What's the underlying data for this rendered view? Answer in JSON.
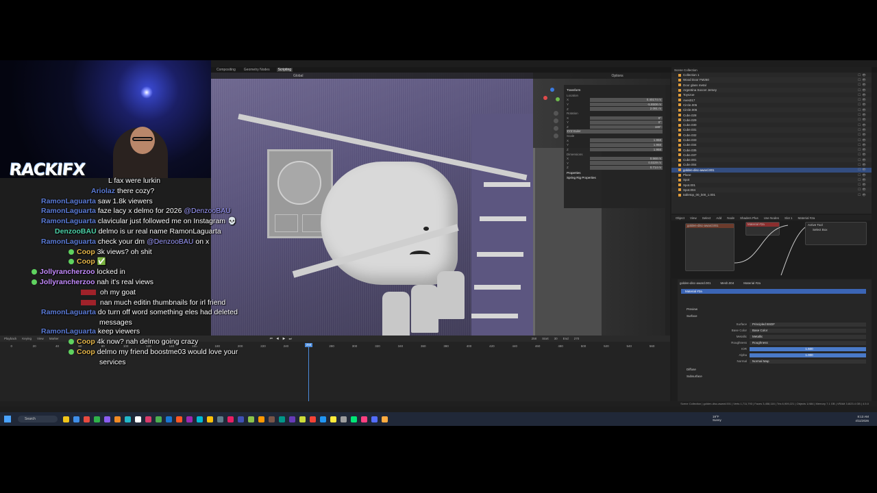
{
  "blender": {
    "workspaces": [
      "Compositing",
      "Geometry Nodes",
      "Scripting"
    ],
    "viewport_header": [
      "Global",
      "Options"
    ],
    "npanel": {
      "transform_title": "Transform",
      "location_label": "Location",
      "location": [
        "0.40174 m",
        "-5.8508 m",
        "2.091 m"
      ],
      "rotation_label": "Rotation",
      "rotation": [
        "0°",
        "0°",
        "180°"
      ],
      "rotation_mode": "XYZ Euler",
      "scale_label": "Scale",
      "scale": [
        "1.958",
        "1.958",
        "1.958"
      ],
      "dimensions_label": "Dimensions",
      "dimensions": [
        "0.568 m",
        "0.0229 m",
        "0.714 m"
      ],
      "properties_label": "Properties",
      "spring_label": "Spring Rig Properties"
    },
    "outliner": {
      "title": "Scene Collection",
      "items": [
        "Collection 1",
        "Wood Door FM260",
        "Door glass metal",
        "Argentina Soccer Jersey",
        "Toyszoe",
        "Aves017",
        "Circle.005",
        "Circle.006",
        "Cube.028",
        "Cube.029",
        "Cube.030",
        "Cube.031",
        "Cube.032",
        "Cube.033",
        "Cube.034",
        "Cube.035",
        "Cube.037",
        "Cube.001",
        "Cube.004",
        "golden-disc-award.001",
        "Plane",
        "Spot",
        "Spot.001",
        "Spot.004",
        "tabletop_00_k00_1.001"
      ],
      "selected_index": 19
    },
    "node_editor": {
      "header": [
        "Object",
        "View",
        "Select",
        "Add",
        "Node",
        "Shaders Plus",
        "Use Nodes",
        "Slot 1",
        "Material #2a"
      ],
      "nodes": [
        "golden-disc-award.001",
        "Material #2a",
        "Active Tool",
        "Select Box"
      ]
    },
    "properties": {
      "breadcrumb": [
        "golden-disc-award.001",
        "Mesh.004",
        "Material #2a"
      ],
      "slot": "Material #2a",
      "preview": "Preview",
      "surface_section": "Surface",
      "rows": [
        {
          "label": "Surface",
          "value": "Principled BSDF"
        },
        {
          "label": "Base Color",
          "value": "Base Color"
        },
        {
          "label": "Metallic",
          "value": "Metallic"
        },
        {
          "label": "Roughness",
          "value": "Roughness"
        },
        {
          "label": "IOR",
          "value": "1.500"
        },
        {
          "label": "Alpha",
          "value": "1.000"
        },
        {
          "label": "Normal",
          "value": "Normal Map"
        }
      ],
      "diffuse": "Diffuse",
      "subsurface": "Subsurface"
    },
    "timeline": {
      "header": [
        "Playback",
        "Keying",
        "View",
        "Marker"
      ],
      "ruler": [
        "0",
        "20",
        "40",
        "60",
        "80",
        "100",
        "120",
        "140",
        "160",
        "180",
        "200",
        "220",
        "240",
        "260",
        "280",
        "300",
        "320",
        "340",
        "360",
        "380",
        "400",
        "420",
        "440",
        "460",
        "480",
        "500",
        "520",
        "540",
        "560"
      ],
      "current_frame": "258",
      "start_label": "Start",
      "start": "30",
      "end_label": "End",
      "end": "270"
    },
    "status": "Scene Collection | golden-disc-award.001 | Verts 1,711,793 | Faces 3,458,116 | Tris 6,909,221 | Objects 1/484 | Memory 7.1 GB | VRAM 3.8/23.4 GB | 4.5.0"
  },
  "taskbar": {
    "search": "Search",
    "weather_temp": "19°F",
    "weather_desc": "Sunny",
    "time": "8:13 AM",
    "date": "4/11/2026"
  },
  "stream": {
    "logo": "RACKIFX",
    "chat": [
      {
        "user": "",
        "text": "L fax were lurkin",
        "user_color": "#ffffff"
      },
      {
        "user": "Ariolaz",
        "text": "there cozy?",
        "user_color": "#5b7bd6"
      },
      {
        "user": "RamonLaguarta",
        "text": "saw 1.8k viewers",
        "user_color": "#5b7bd6"
      },
      {
        "user": "RamonLaguarta",
        "text": "faze lacy x delmo for 2026",
        "mention": "@DenzooBAU",
        "user_color": "#5b7bd6"
      },
      {
        "user": "RamonLaguarta",
        "text": "clavicular just followed me on Instagram 💀",
        "user_color": "#5b7bd6"
      },
      {
        "user": "DenzooBAU",
        "text": "delmo is ur real name RamonLaguarta",
        "user_color": "#4cd2a8"
      },
      {
        "user": "RamonLaguarta",
        "text": "check your dm",
        "mention": "@DenzooBAU",
        "suffix": "on x",
        "user_color": "#5b7bd6"
      },
      {
        "user": "Coop",
        "text": "3k views? oh shit",
        "user_color": "#e8b84a",
        "badge": true
      },
      {
        "user": "Coop",
        "text": "",
        "user_color": "#e8b84a",
        "badge": true,
        "emote": true
      },
      {
        "user": "Jollyrancherzoo",
        "text": "locked in",
        "user_color": "#c58cff",
        "badge": true
      },
      {
        "user": "Jollyrancherzoo",
        "text": "nah it's real views",
        "user_color": "#c58cff",
        "badge": true
      },
      {
        "user": "",
        "text": "oh my goat",
        "user_color": "#ffffff",
        "red": true
      },
      {
        "user": "",
        "text": "nan much editin thumbnails for irl friend",
        "user_color": "#ffffff",
        "red": true
      },
      {
        "user": "RamonLaguarta",
        "text": "do turn off word something eles had deleted",
        "text2": "messages",
        "user_color": "#5b7bd6"
      },
      {
        "user": "RamonLaguarta",
        "text": "keep viewers",
        "user_color": "#5b7bd6"
      },
      {
        "user": "Coop",
        "text": "4k now? nah delmo going crazy",
        "user_color": "#e8b84a",
        "badge": true
      },
      {
        "user": "Coop",
        "text": "delmo my friend boostme03 would love your",
        "text2": "services",
        "user_color": "#e8b84a",
        "badge": true
      }
    ]
  }
}
